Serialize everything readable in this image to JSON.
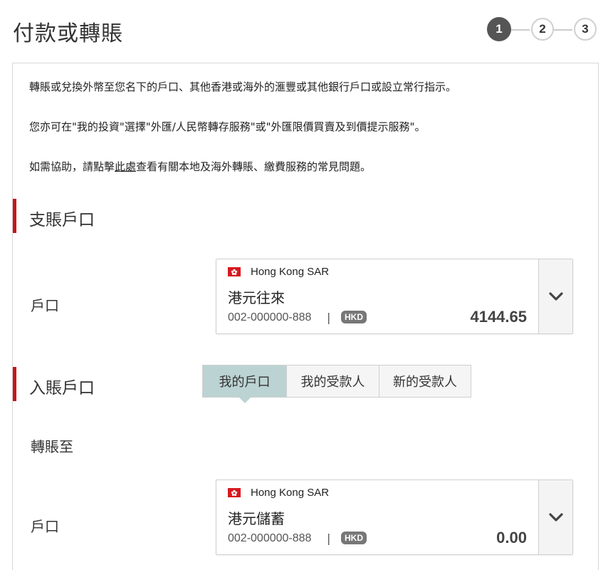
{
  "page": {
    "title": "付款或轉賬"
  },
  "stepper": {
    "steps": [
      "1",
      "2",
      "3"
    ],
    "active": 1,
    "active_color": "#555555"
  },
  "intro": {
    "line1": "轉賬或兌換外幣至您名下的戶口、其他香港或海外的滙豐或其他銀行戶口或設立常行指示。",
    "line2": "您亦可在\"我的投資\"選擇\"外匯/人民幣轉存服務\"或\"外匯限價買賣及到價提示服務\"。",
    "line3_prefix": "如需協助，請點擊",
    "line3_link": "此處",
    "line3_suffix": "查看有關本地及海外轉賬、繳費服務的常見問題。"
  },
  "from_section": {
    "title": "支賬戶口",
    "account_label": "戶口",
    "account": {
      "region": "Hong Kong SAR",
      "name": "港元往來",
      "number": "002-000000-888",
      "separator": "|",
      "currency": "HKD",
      "balance": "4144.65"
    }
  },
  "to_section": {
    "title": "入賬戶口",
    "transfer_to_label": "轉賬至",
    "tabs": [
      "我的戶口",
      "我的受款人",
      "新的受款人"
    ],
    "selected_tab": 0,
    "account_label": "戶口",
    "account": {
      "region": "Hong Kong SAR",
      "name": "港元儲蓄",
      "number": "002-000000-888",
      "separator": "|",
      "currency": "HKD",
      "balance": "0.00"
    }
  },
  "colors": {
    "accent_red": "#c4161c",
    "selected_tab": "#bcd3d3",
    "flag_red": "#d71920"
  },
  "icons": {
    "flag": "hong-kong-flag-icon",
    "dropdown": "chevron-down-icon"
  }
}
